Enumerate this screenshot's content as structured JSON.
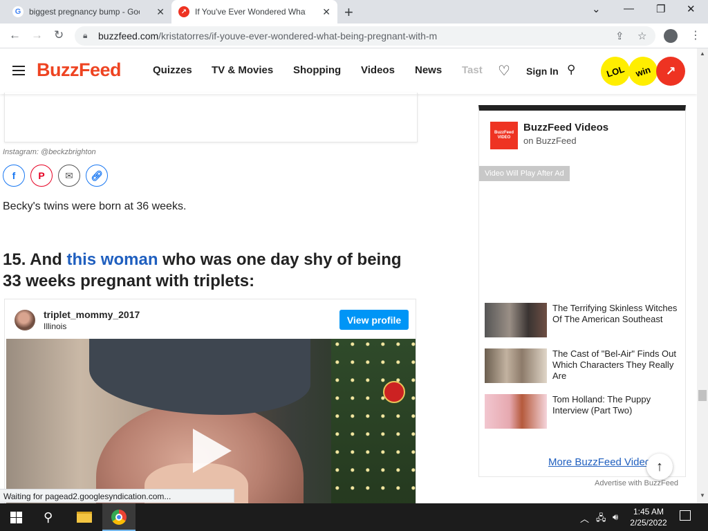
{
  "browser": {
    "tabs": [
      {
        "label": "biggest pregnancy bump - Google Search",
        "icon": "google-icon"
      },
      {
        "label": "If You've Ever Wondered What Being Pregnant",
        "icon": "buzzfeed-icon"
      }
    ],
    "url_host": "buzzfeed.com",
    "url_path": "/kristatorres/if-youve-ever-wondered-what-being-pregnant-with-m",
    "status_text": "Waiting for pagead2.googlesyndication.com..."
  },
  "site": {
    "logo": "BuzzFeed",
    "nav": [
      "Quizzes",
      "TV & Movies",
      "Shopping",
      "Videos",
      "News",
      "Tasty"
    ],
    "sign_in": "Sign In",
    "badges": {
      "lol": "LOL",
      "win": "win"
    },
    "accent_color": "#ee3322"
  },
  "article": {
    "credit": "Instagram: @beckzbrighton",
    "paragraph": "Becky's twins were born at 36 weeks.",
    "headline_prefix": "15. And ",
    "headline_link": "this woman",
    "headline_suffix": " who was one day shy of being 33 weeks pregnant with triplets:",
    "instagram": {
      "username": "triplet_mommy_2017",
      "location": "Illinois",
      "view_profile": "View profile"
    }
  },
  "sidebar": {
    "logo_text": "BuzzFeed VIDEO",
    "title": "BuzzFeed Videos",
    "subtitle": "on BuzzFeed",
    "play_notice": "Video Will Play After Ad",
    "videos": [
      {
        "title": "The Terrifying Skinless Witches Of The American Southeast"
      },
      {
        "title": "The Cast of \"Bel-Air\" Finds Out Which Characters They Really Are"
      },
      {
        "title": "Tom Holland: The Puppy Interview (Part Two)"
      }
    ],
    "more_link": "More BuzzFeed Videos",
    "advertise": "Advertise with BuzzFeed"
  },
  "taskbar": {
    "time": "1:45 AM",
    "date": "2/25/2022"
  }
}
